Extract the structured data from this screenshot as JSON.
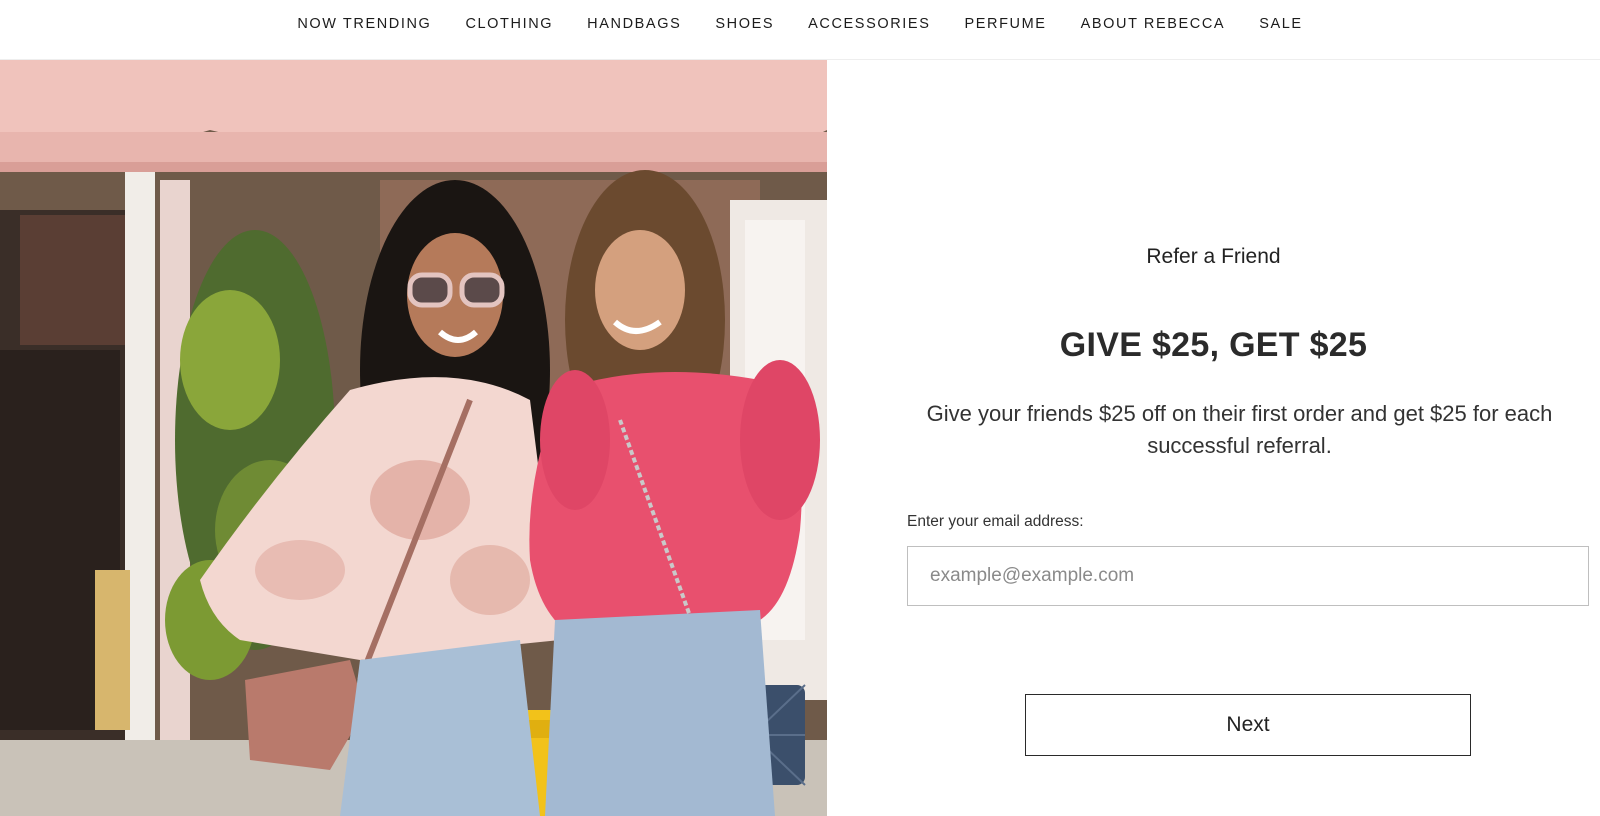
{
  "nav": {
    "items": [
      {
        "label": "NOW TRENDING"
      },
      {
        "label": "CLOTHING"
      },
      {
        "label": "HANDBAGS"
      },
      {
        "label": "SHOES"
      },
      {
        "label": "ACCESSORIES"
      },
      {
        "label": "PERFUME"
      },
      {
        "label": "ABOUT REBECCA"
      },
      {
        "label": "SALE"
      }
    ]
  },
  "referral": {
    "eyebrow": "Refer a Friend",
    "headline": "GIVE $25, GET $25",
    "description": "Give your friends $25 off on their first order and get $25 for each successful referral.",
    "email_label": "Enter your email address:",
    "email_placeholder": "example@example.com",
    "email_value": "",
    "next_label": "Next"
  },
  "colors": {
    "awning_pink": "#f0c3bc",
    "sweater_pink": "#e8506e",
    "tie_dye": "#f3d7d0",
    "denim": "#a9bfd6",
    "bag_navy": "#3b4f6b",
    "bag_rose": "#b97a6c",
    "hydrant_yellow": "#f2c21a"
  }
}
